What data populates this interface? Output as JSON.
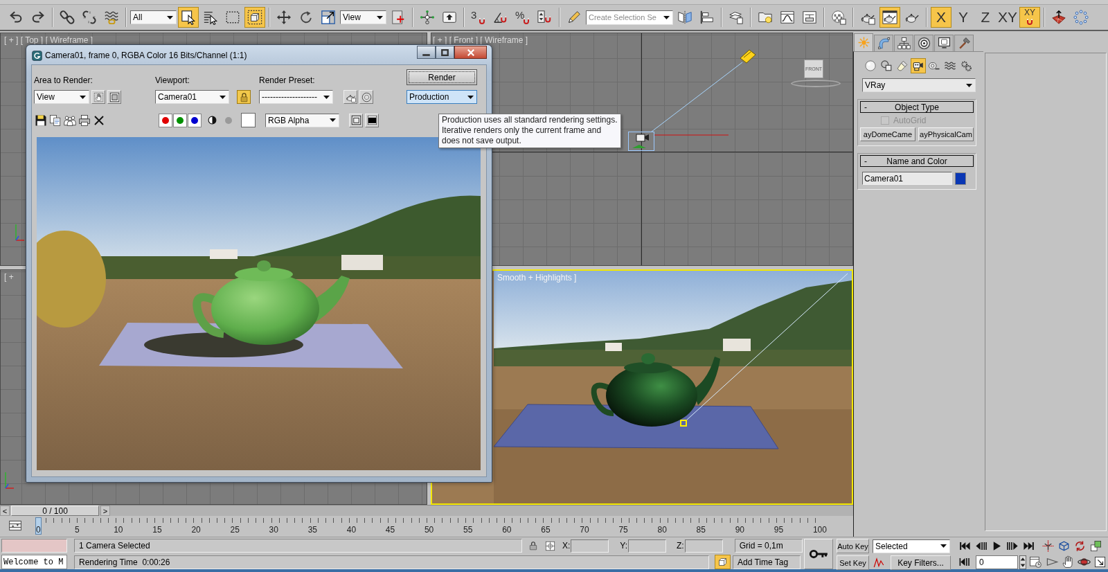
{
  "toolbar": {
    "groups": [
      [
        {
          "kind": "icon",
          "active": false
        },
        {
          "kind": "icon",
          "active": false
        }
      ],
      [
        {
          "kind": "icon",
          "active": false
        },
        {
          "kind": "icon",
          "active": false
        },
        {
          "kind": "icon",
          "active": false
        }
      ],
      [
        {
          "kind": "dropdown",
          "value": "All"
        },
        {
          "kind": "icon",
          "active": true
        },
        {
          "kind": "icon",
          "active": false
        },
        {
          "kind": "icon",
          "active": false
        },
        {
          "kind": "icon",
          "active": true
        }
      ],
      [
        {
          "kind": "icon",
          "active": false
        },
        {
          "kind": "icon",
          "active": false
        },
        {
          "kind": "icon",
          "active": false
        },
        {
          "kind": "dropdown",
          "value": "View"
        },
        {
          "kind": "icon",
          "active": false
        }
      ],
      [
        {
          "kind": "icon",
          "active": false
        },
        {
          "kind": "icon",
          "active": false
        }
      ],
      [
        {
          "kind": "snap",
          "label": "3",
          "active": false
        },
        {
          "kind": "snap",
          "active": false
        },
        {
          "kind": "snap",
          "label": "%",
          "active": false
        },
        {
          "kind": "snap",
          "active": false
        }
      ],
      [
        {
          "kind": "icon",
          "active": false
        },
        {
          "kind": "field",
          "placeholder": "Create Selection Se"
        },
        {
          "kind": "icon",
          "active": false
        },
        {
          "kind": "icon",
          "active": false
        }
      ],
      [
        {
          "kind": "icon",
          "active": false
        }
      ],
      [
        {
          "kind": "icon",
          "active": false
        },
        {
          "kind": "icon",
          "active": false
        },
        {
          "kind": "icon",
          "active": false
        }
      ],
      [
        {
          "kind": "icon",
          "active": false
        }
      ],
      [
        {
          "kind": "icon",
          "active": false
        },
        {
          "kind": "icon",
          "active": true
        },
        {
          "kind": "icon",
          "active": false
        }
      ],
      [
        {
          "kind": "axis",
          "label": "X",
          "active": true
        },
        {
          "kind": "axis",
          "label": "Y",
          "active": false
        },
        {
          "kind": "axis",
          "label": "Z",
          "active": false
        },
        {
          "kind": "axis",
          "label": "XY",
          "active": false
        },
        {
          "kind": "axis_magnet",
          "label": "XY",
          "active": true
        }
      ],
      [
        {
          "kind": "icon",
          "active": false
        },
        {
          "kind": "icon",
          "active": false
        }
      ]
    ]
  },
  "viewports": [
    {
      "kind": "top",
      "label": "[ + ] [ Top ] [ Wireframe ]",
      "active": false
    },
    {
      "kind": "front",
      "label": "[ + ] [ Front ] [ Wireframe ]",
      "active": false,
      "viewcube": "FRONT"
    },
    {
      "kind": "left",
      "label": "[ +",
      "active": false
    },
    {
      "kind": "camera",
      "label": "Smooth + Highlights ]",
      "active": true
    }
  ],
  "render_window": {
    "title": "Camera01, frame 0, RGBA Color 16 Bits/Channel (1:1)",
    "area_label": "Area to Render:",
    "area_value": "View",
    "viewport_label": "Viewport:",
    "viewport_value": "Camera01",
    "viewport_locked": true,
    "preset_label": "Render Preset:",
    "preset_value": "--------------------",
    "render_button": "Render",
    "mode_value": "Production",
    "mode_focused": true,
    "channels": [
      {
        "color": "#e00000",
        "on": true
      },
      {
        "color": "#009000",
        "on": true
      },
      {
        "color": "#0000d0",
        "on": true
      }
    ],
    "display_value": "RGB Alpha",
    "tooltip": "Production uses all standard rendering settings.\nIterative renders only the current frame and\ndoes not save output."
  },
  "command_panel": {
    "tabs": [
      {
        "selected": true
      },
      {
        "selected": false
      },
      {
        "selected": false
      },
      {
        "selected": false
      },
      {
        "selected": false
      },
      {
        "selected": false
      }
    ],
    "categories": [
      {
        "selected": false
      },
      {
        "selected": false
      },
      {
        "selected": false
      },
      {
        "selected": true
      },
      {
        "selected": false
      },
      {
        "selected": false
      },
      {
        "selected": false
      }
    ],
    "type_value": "VRay",
    "rollouts": [
      {
        "kind": "object_type",
        "toggle": "-",
        "title": "Object Type",
        "autogrid": {
          "label": "AutoGrid",
          "checked": false,
          "disabled": true
        },
        "buttons": [
          "ayDomeCame",
          "ayPhysicalCam"
        ]
      },
      {
        "kind": "name_color",
        "toggle": "-",
        "title": "Name and Color",
        "name": "Camera01",
        "color": "#0a37b4"
      }
    ]
  },
  "time_slider": {
    "prev": "<",
    "position": "0 / 100",
    "next": ">",
    "level": 0
  },
  "trackbar": {
    "labels": [
      "0",
      "5",
      "10",
      "15",
      "20",
      "25",
      "30",
      "35",
      "40",
      "45",
      "50",
      "55",
      "60",
      "65",
      "70",
      "75",
      "80",
      "85",
      "90",
      "95",
      "100"
    ],
    "level": 0
  },
  "status_bar": {
    "listener_output": "Welcome to M",
    "prompt": "1 Camera Selected",
    "render_time": "Rendering Time  0:00:26",
    "x_label": "X:",
    "y_label": "Y:",
    "z_label": "Z:",
    "grid": "Grid = 0,1m",
    "tag_toggle_active": true,
    "add_time_tag": "Add Time Tag",
    "auto_key": {
      "label": "Auto Key",
      "on": false
    },
    "key_set": "Selected",
    "set_key": {
      "label": "Set Key",
      "on": false
    },
    "key_filters": "Key Filters...",
    "frame": "0"
  }
}
